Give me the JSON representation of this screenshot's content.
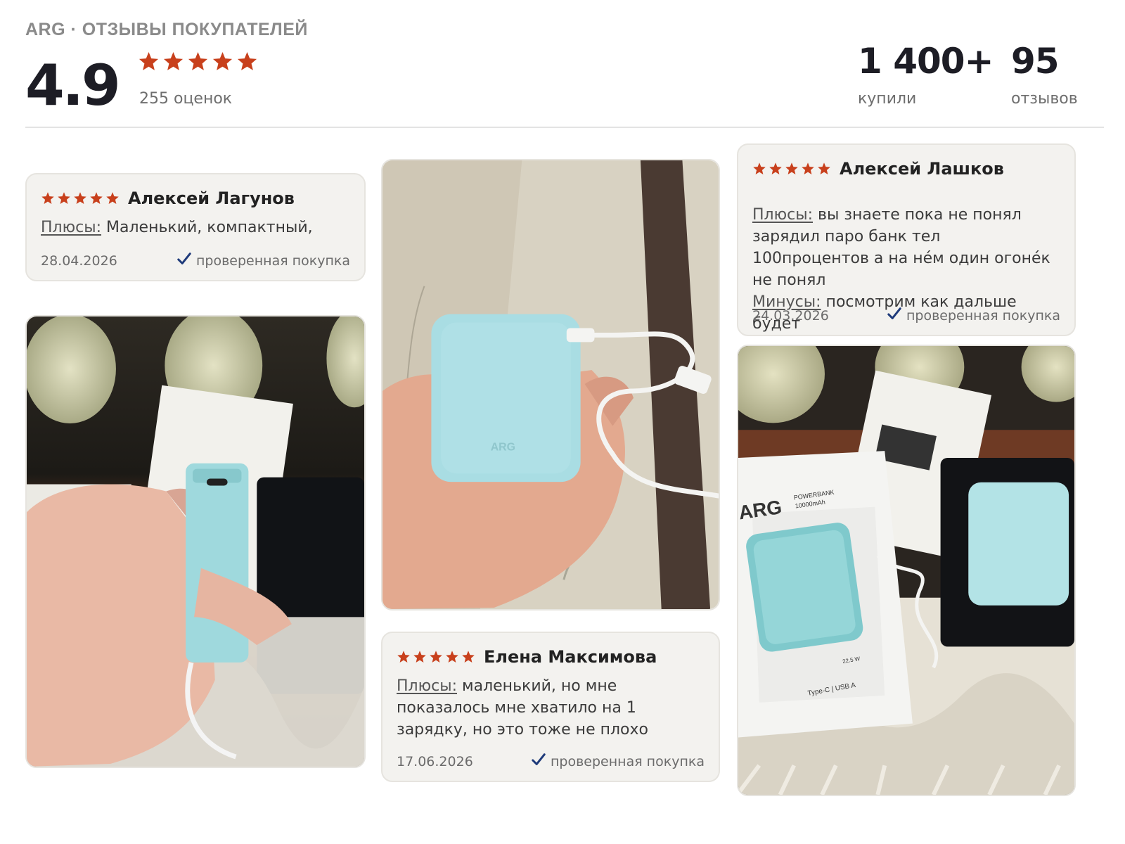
{
  "header": {
    "brand_line": "ARG · ОТЗЫВЫ ПОКУПАТЕЛЕЙ",
    "rating": "4.9",
    "rating_count": "255 оценок",
    "stars": 5,
    "bought_value": "1 400+",
    "bought_label": "купили",
    "reviews_value": "95",
    "reviews_label": "отзывов"
  },
  "colors": {
    "star": "#c8401c",
    "check": "#1e3a7a",
    "card_bg": "#f3f2ef",
    "powerbank": "#a9dde0"
  },
  "reviews": [
    {
      "author": "Алексей Лагунов",
      "rating": 5,
      "pros_label": "Плюсы:",
      "pros_text": " Маленький, компактный,",
      "date": "28.04.2026",
      "verified": "проверенная покупка"
    },
    {
      "author": "Елена Максимова",
      "rating": 5,
      "pros_label": "Плюсы:",
      "pros_text": " маленький, но мне показалось мне хватило на 1 зарядку, но это тоже не плохо",
      "date": "17.06.2026",
      "verified": "проверенная покупка"
    },
    {
      "author": "Алексей Лашков",
      "rating": 5,
      "pros_label": "Плюсы:",
      "pros_text": " вы знаете пока не понял зарядил паро банк тел 100процентов а на не́м один огоне́к не понял",
      "cons_label": "Минусы:",
      "cons_text": " посмотрим как дальше будет",
      "date": "24.03.2026",
      "verified": "проверенная покупка"
    }
  ],
  "photos": {
    "brand_mark": "ARG",
    "box_product": "POWERBANK",
    "box_capacity": "10000mAh",
    "box_ports": "Type-C | USB A",
    "box_power": "22.5 W"
  }
}
